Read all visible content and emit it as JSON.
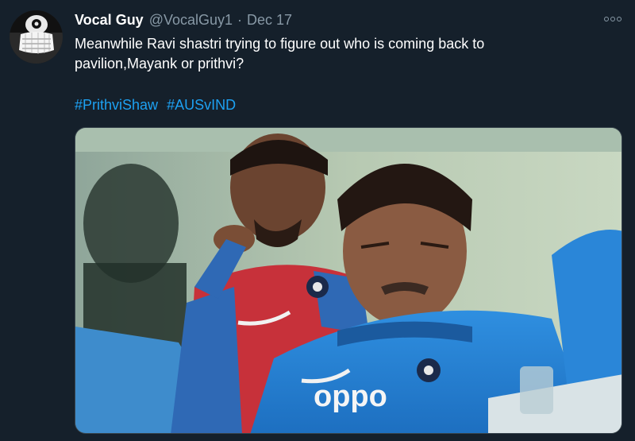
{
  "tweet": {
    "author_name": "Vocal Guy",
    "author_handle": "@VocalGuy1",
    "separator": "·",
    "date": "Dec 17",
    "text_line1": "Meanwhile Ravi shastri trying to figure out who is coming back to",
    "text_line2": "pavilion,Mayank or prithvi?",
    "hashtags": [
      "#PrithviShaw",
      "#AUSvIND"
    ],
    "media_jersey_text": "oppo"
  },
  "icons": {
    "more": "more-icon",
    "avatar": "avatar"
  },
  "colors": {
    "background": "#15202b",
    "link": "#1da1f2",
    "secondary_text": "#8899a6"
  }
}
